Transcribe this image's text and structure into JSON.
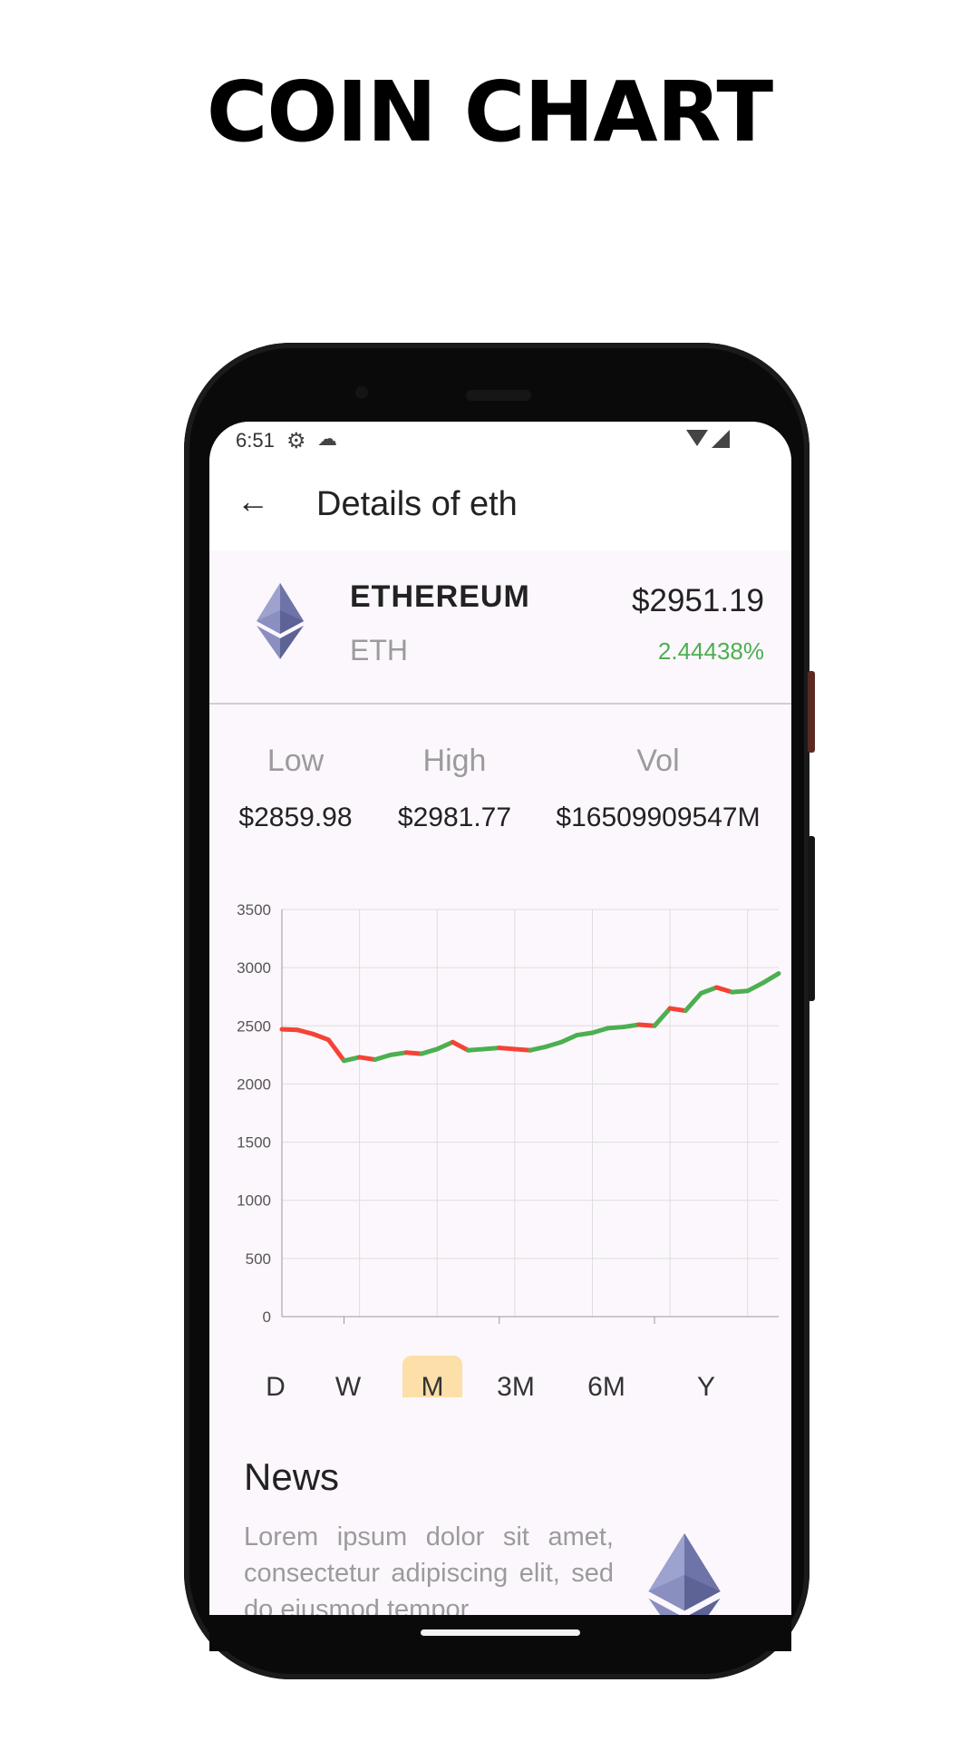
{
  "headline": "COIN CHART",
  "status": {
    "time": "6:51"
  },
  "appbar": {
    "title": "Details of eth"
  },
  "coin": {
    "name": "ETHEREUM",
    "symbol": "ETH",
    "price": "$2951.19",
    "change": "2.44438%",
    "change_color": "#4caf50"
  },
  "stats": {
    "low_label": "Low",
    "low_value": "$2859.98",
    "high_label": "High",
    "high_value": "$2981.77",
    "vol_label": "Vol",
    "vol_value": "$16509909547M"
  },
  "chart_data": {
    "type": "line",
    "xlabel": "",
    "ylabel": "",
    "ylim": [
      0,
      3500
    ],
    "xlim": [
      1705600000000,
      1708800000000
    ],
    "y_ticks": [
      "0",
      "500",
      "1000",
      "1500",
      "2000",
      "2500",
      "3000",
      "3500"
    ],
    "x_ticks": [
      "1706000000000",
      "1707000000000",
      "1708000000000"
    ],
    "up_color": "#4caf50",
    "down_color": "#f44336",
    "grid": true,
    "series": [
      {
        "x": [
          1705600000000,
          1705700000000,
          1705800000000,
          1705900000000,
          1706000000000,
          1706100000000,
          1706200000000,
          1706300000000,
          1706400000000,
          1706500000000,
          1706600000000,
          1706700000000,
          1706800000000,
          1706900000000,
          1707000000000,
          1707100000000,
          1707200000000,
          1707300000000,
          1707400000000,
          1707500000000,
          1707600000000,
          1707700000000,
          1707800000000,
          1707900000000,
          1708000000000,
          1708100000000,
          1708200000000,
          1708300000000,
          1708400000000,
          1708500000000,
          1708600000000,
          1708700000000,
          1708800000000
        ],
        "values": [
          2470,
          2465,
          2430,
          2380,
          2200,
          2230,
          2210,
          2250,
          2270,
          2260,
          2300,
          2360,
          2290,
          2300,
          2310,
          2300,
          2290,
          2320,
          2360,
          2420,
          2440,
          2480,
          2490,
          2510,
          2500,
          2650,
          2630,
          2780,
          2830,
          2790,
          2800,
          2870,
          2950
        ]
      }
    ]
  },
  "periods": {
    "items": [
      "D",
      "W",
      "M",
      "3M",
      "6M",
      "Y"
    ],
    "active_color": "#fcdfa9"
  },
  "news": {
    "title": "News",
    "text": "Lorem ipsum dolor sit amet, consectetur adipiscing elit, sed do eiusmod tempor"
  }
}
